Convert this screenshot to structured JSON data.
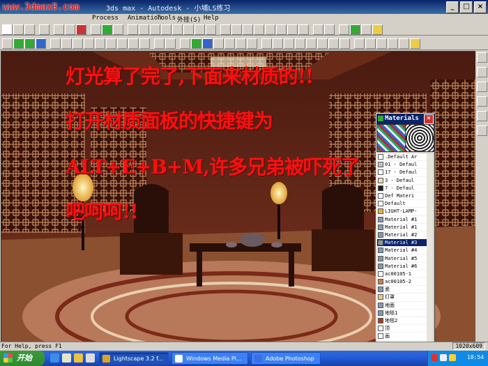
{
  "window": {
    "watermark": "www.3dmax8.com",
    "title": "3ds max - Autodesk - 小埔LS练习",
    "controls": [
      "_",
      "□",
      "×"
    ]
  },
  "menu": {
    "items": [
      "Process",
      "Animation",
      "Tools",
      "外挂(S)",
      "Help"
    ]
  },
  "caption": {
    "line1": "灯光算了完了,下面来材质的!!",
    "line2": "打开材质面板的快捷键为",
    "line3": "ALT+E+B+M,许多兄弟被吓死了",
    "line4": "吧呵呵!!"
  },
  "materials_panel": {
    "title": "Materials",
    "close": "×",
    "items": [
      {
        "label": ".Default Ar",
        "color": "#ffffff",
        "selected": false
      },
      {
        "label": "01 - Defaul",
        "color": "#c0c0c0",
        "selected": false
      },
      {
        "label": "17 - Defaul",
        "color": "#ffffff",
        "selected": false
      },
      {
        "label": "3 - Defaul",
        "color": "#f0d8b0",
        "selected": false
      },
      {
        "label": "7 - Defaul",
        "color": "#202020",
        "selected": false
      },
      {
        "label": "Def Materi",
        "color": "#ffffff",
        "selected": false
      },
      {
        "label": "Default",
        "color": "#ffffff",
        "selected": false
      },
      {
        "label": "LIGHT-LAMP-",
        "color": "#e8b040",
        "selected": false
      },
      {
        "label": "Material #1",
        "color": "#8899aa",
        "selected": false
      },
      {
        "label": "Material #1",
        "color": "#8899aa",
        "selected": false
      },
      {
        "label": "Material #2",
        "color": "#8899aa",
        "selected": false
      },
      {
        "label": "Material #3",
        "color": "#8899aa",
        "selected": true
      },
      {
        "label": "Material #4",
        "color": "#8899aa",
        "selected": false
      },
      {
        "label": "Material #5",
        "color": "#8899aa",
        "selected": false
      },
      {
        "label": "Material #6",
        "color": "#8899aa",
        "selected": false
      },
      {
        "label": "ac00105-1",
        "color": "#ffffff",
        "selected": false
      },
      {
        "label": "ac00105-2",
        "color": "#c88050",
        "selected": false
      },
      {
        "label": "瓷",
        "color": "#8899aa",
        "selected": false
      },
      {
        "label": "灯罩",
        "color": "#e8c890",
        "selected": false
      },
      {
        "label": "地面",
        "color": "#8899aa",
        "selected": false
      },
      {
        "label": "地毯1",
        "color": "#8899aa",
        "selected": false
      },
      {
        "label": "地毯2",
        "color": "#a04020",
        "selected": false
      },
      {
        "label": "顶",
        "color": "#ffffff",
        "selected": false
      },
      {
        "label": "画",
        "color": "#ffffff",
        "selected": false
      }
    ]
  },
  "status": {
    "help": "For Help, press F1",
    "resolution": "1020x609"
  },
  "taskbar": {
    "start": "开始",
    "tasks": [
      {
        "label": "Lightscape 3.2 f...",
        "active": true
      },
      {
        "label": "Windows Media Pl...",
        "active": false
      },
      {
        "label": "Adobe Photoshop",
        "active": false
      }
    ],
    "clock": "18:54"
  }
}
